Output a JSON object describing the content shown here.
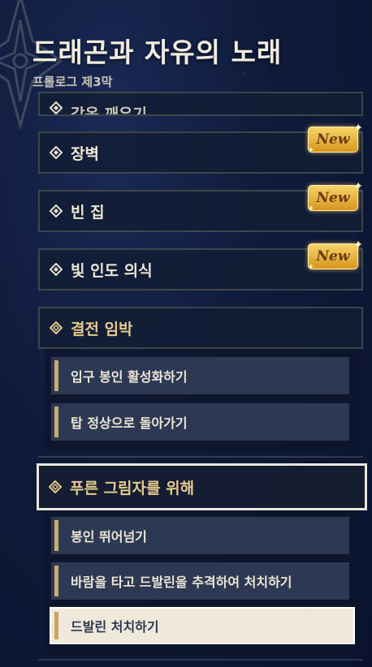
{
  "header": {
    "title": "드래곤과 자유의 노래",
    "subtitle": "프롤로그 제3막"
  },
  "badge_label": "New",
  "chapters": [
    {
      "name": "감옥 깨우기",
      "state": "clipped"
    },
    {
      "name": "장벽",
      "badge": true
    },
    {
      "name": "빈 집",
      "badge": true
    },
    {
      "name": "빛 인도 의식",
      "badge": true
    },
    {
      "name": "결전 임박",
      "state": "open"
    },
    {
      "name": "푸른 그림자를 위해",
      "state": "selected"
    }
  ],
  "quests_showdown": [
    "입구 봉인 활성화하기",
    "탑 정상으로 돌아가기"
  ],
  "quests_blue_shadow": [
    "봉인 뛰어넘기",
    "바람을 타고 드발린을 추격하여 처치하기",
    "드발린 처치하기"
  ],
  "colors": {
    "accent_gold": "#e6c98d",
    "badge_gold": "#f7d46a",
    "bg": "#0f1a3a"
  }
}
